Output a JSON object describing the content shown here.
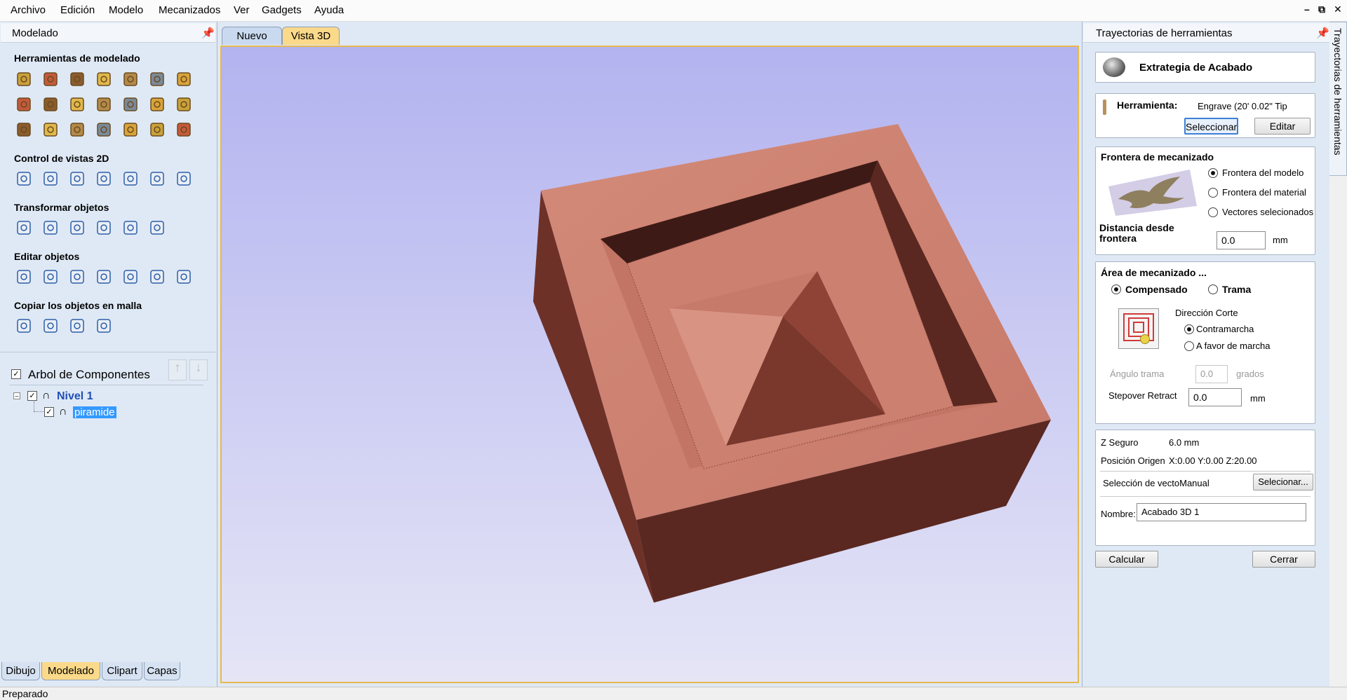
{
  "menu": [
    "Archivo",
    "Edición",
    "Modelo",
    "Mecanizados",
    "Ver",
    "Gadgets",
    "Ayuda"
  ],
  "left_panel": {
    "title": "Modelado",
    "sections": [
      "Herramientas de modelado",
      "Control de vistas 2D",
      "Transformar objetos",
      "Editar objetos",
      "Copiar los objetos en malla"
    ],
    "tree": {
      "title": "Arbol de Componentes",
      "level": "Nivel 1",
      "component": "piramide"
    },
    "tabs": [
      "Dibujo",
      "Modelado",
      "Clipart",
      "Capas"
    ],
    "active_tab": "Modelado"
  },
  "doc_tabs": [
    "Nuevo",
    "Vista 3D"
  ],
  "active_doc_tab": "Vista 3D",
  "right_panel": {
    "title": "Trayectorias de herramientas",
    "strategy": "Extrategia de Acabado",
    "tool": {
      "label": "Herramienta:",
      "value": "Engrave (20' 0.02\" Tip",
      "select": "Seleccionar",
      "edit": "Editar"
    },
    "boundary": {
      "title": "Frontera de mecanizado",
      "options": [
        "Frontera del modelo",
        "Frontera del material",
        "Vectores selecionados"
      ],
      "selected": "Frontera del modelo",
      "distance_label": "Distancia desde frontera",
      "distance_value": "0.0",
      "unit": "mm"
    },
    "area": {
      "title": "Área de mecanizado ...",
      "options": [
        "Compensado",
        "Trama"
      ],
      "selected": "Compensado",
      "direction_label": "Dirección Corte",
      "directions": [
        "Contramarcha",
        "A favor de marcha"
      ],
      "direction_selected": "Contramarcha",
      "angle_label": "Ángulo trama",
      "angle_value": "0.0",
      "angle_unit": "grados",
      "stepover_label": "Stepover Retract",
      "stepover_value": "0.0",
      "stepover_unit": "mm"
    },
    "info": {
      "z_label": "Z Seguro",
      "z_value": "6.0 mm",
      "origin_label": "Posición Origen",
      "origin_value": "X:0.00 Y:0.00 Z:20.00",
      "vector_label": "Selección de vectoManual",
      "vector_button": "Selecionar...",
      "name_label": "Nombre:",
      "name_value": "Acabado 3D 1"
    },
    "calc_button": "Calcular",
    "close_button": "Cerrar"
  },
  "side_tab": "Trayectorias de herramientas",
  "status": "Preparado",
  "colors": {
    "accent": "#fbd98a",
    "panel": "#dfe9f5",
    "wood": "#c97866",
    "selection": "#3399ff"
  }
}
